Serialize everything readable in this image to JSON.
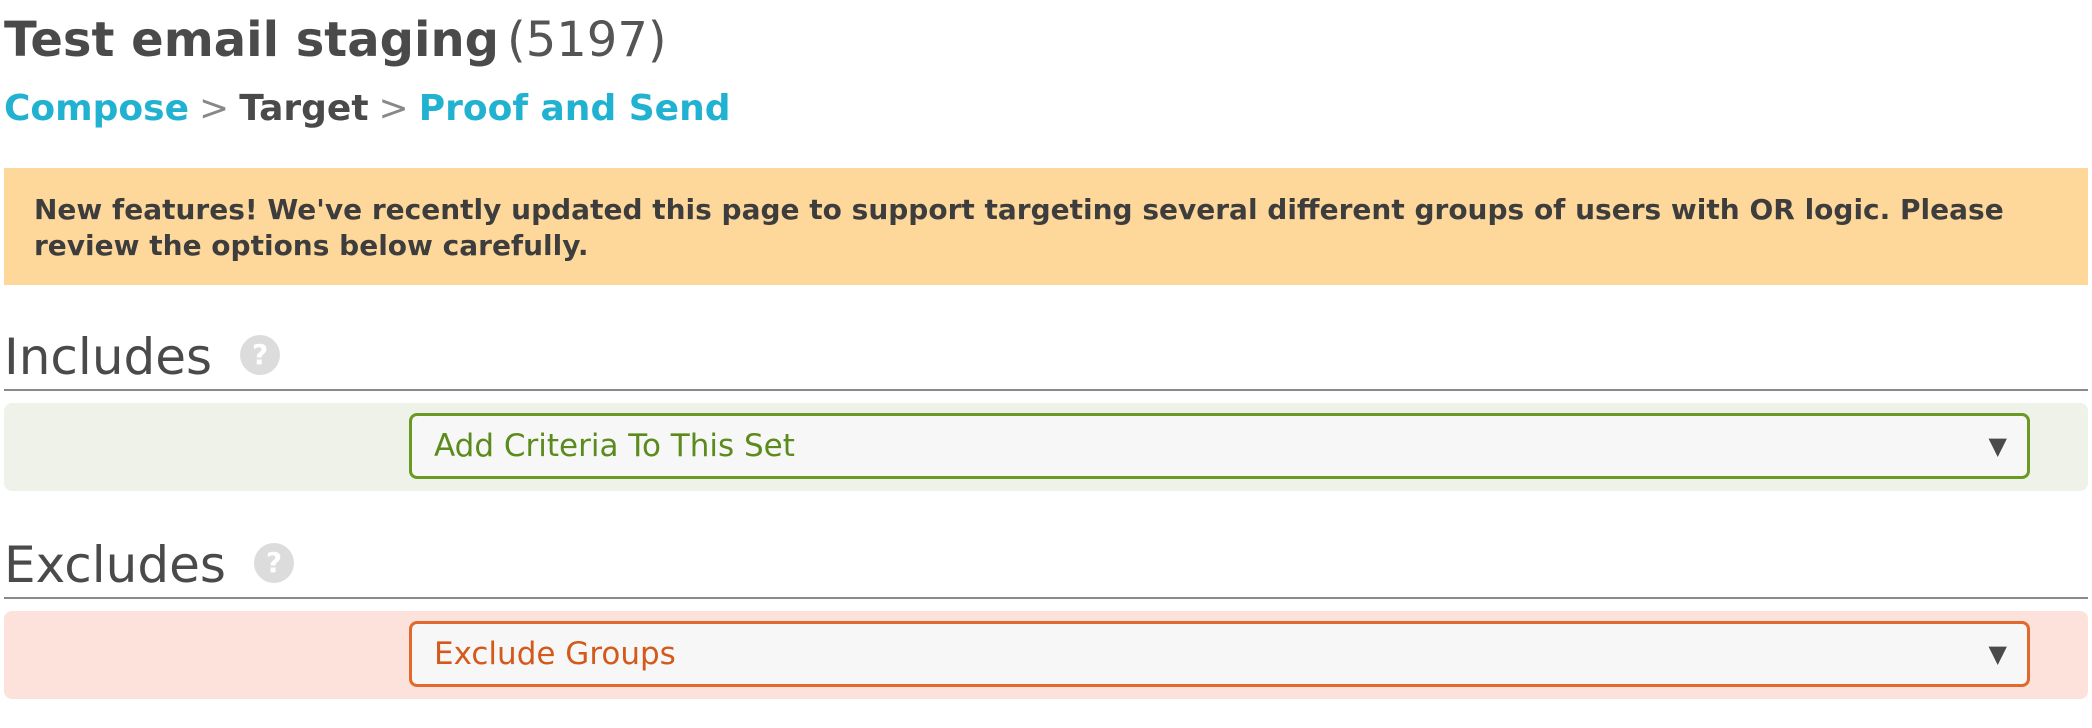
{
  "header": {
    "title": "Test email staging",
    "count": "(5197)"
  },
  "breadcrumb": {
    "compose": "Compose",
    "separator": ">",
    "target": "Target",
    "proof_and_send": "Proof and Send"
  },
  "notice": {
    "text": "New features! We've recently updated this page to support targeting several different groups of users with OR logic. Please review the options below carefully."
  },
  "includes": {
    "title": "Includes",
    "help": "?",
    "select_value": "Add Criteria To This Set",
    "caret": "▼"
  },
  "excludes": {
    "title": "Excludes",
    "help": "?",
    "select_value": "Exclude Groups",
    "caret": "▼"
  },
  "colors": {
    "link": "#22b2d1",
    "notice_bg": "#fed89b",
    "include_border": "#6a9a23",
    "include_bg": "#eef2e9",
    "exclude_border": "#e2692e",
    "exclude_bg": "#fde1db"
  },
  "icons": {
    "help": "question-circle-icon",
    "dropdown": "caret-down-icon"
  }
}
